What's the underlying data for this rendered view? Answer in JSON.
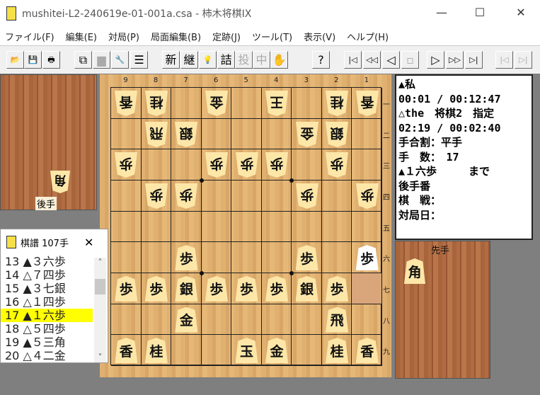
{
  "window": {
    "title": "mushitei-L2-240619e-01-001a.csa - 柿木将棋IX",
    "minimize": "—",
    "maximize": "☐",
    "close": "✕",
    "logo": "柿"
  },
  "menu": [
    "ファイル(F)",
    "編集(E)",
    "対局(P)",
    "局面編集(B)",
    "定跡(J)",
    "ツール(T)",
    "表示(V)",
    "ヘルプ(H)"
  ],
  "toolbar": [
    {
      "name": "open-button",
      "glyph": "📂",
      "enabled": true
    },
    {
      "name": "save-button",
      "glyph": "💾",
      "enabled": true
    },
    {
      "name": "print-button",
      "glyph": "🖶",
      "enabled": true
    },
    {
      "name": "copy-button",
      "glyph": "⧉",
      "enabled": true
    },
    {
      "name": "paste-button",
      "glyph": "▆",
      "enabled": false
    },
    {
      "name": "settings-button",
      "glyph": "🔧",
      "enabled": true
    },
    {
      "name": "list-button",
      "glyph": "☰",
      "enabled": true
    },
    {
      "name": "new-game-button",
      "glyph": "新",
      "enabled": true
    },
    {
      "name": "continue-button",
      "glyph": "継",
      "enabled": true
    },
    {
      "name": "hint-button",
      "glyph": "💡",
      "enabled": true
    },
    {
      "name": "tsume-button",
      "glyph": "詰",
      "enabled": true
    },
    {
      "name": "resign-button",
      "glyph": "投",
      "enabled": false
    },
    {
      "name": "pause-button",
      "glyph": "中",
      "enabled": false
    },
    {
      "name": "hand-button",
      "glyph": "✋",
      "enabled": false
    },
    {
      "name": "help-button",
      "glyph": "?",
      "enabled": true
    },
    {
      "name": "first-move-button",
      "glyph": "|◁",
      "enabled": true
    },
    {
      "name": "back-many-button",
      "glyph": "◁◁",
      "enabled": true
    },
    {
      "name": "back-button",
      "glyph": "◁",
      "enabled": true
    },
    {
      "name": "stop-button",
      "glyph": "▫",
      "enabled": false
    },
    {
      "name": "forward-button",
      "glyph": "▷",
      "enabled": true
    },
    {
      "name": "forward-many-button",
      "glyph": "▷▷",
      "enabled": true
    },
    {
      "name": "last-move-button",
      "glyph": "▷|",
      "enabled": true
    },
    {
      "name": "branch-back-button",
      "glyph": "|◁",
      "enabled": false
    },
    {
      "name": "branch-forward-button",
      "glyph": "▷|",
      "enabled": false
    }
  ],
  "board": {
    "files": [
      "9",
      "8",
      "7",
      "6",
      "5",
      "4",
      "3",
      "2",
      "1"
    ],
    "ranks": [
      "一",
      "二",
      "三",
      "四",
      "五",
      "六",
      "七",
      "八",
      "九"
    ],
    "highlight": {
      "file": 1,
      "rank": 7
    },
    "pieces": [
      {
        "f": 9,
        "r": 1,
        "p": "香",
        "o": "gote"
      },
      {
        "f": 8,
        "r": 1,
        "p": "桂",
        "o": "gote"
      },
      {
        "f": 6,
        "r": 1,
        "p": "金",
        "o": "gote"
      },
      {
        "f": 4,
        "r": 1,
        "p": "王",
        "o": "gote"
      },
      {
        "f": 2,
        "r": 1,
        "p": "桂",
        "o": "gote"
      },
      {
        "f": 1,
        "r": 1,
        "p": "香",
        "o": "gote"
      },
      {
        "f": 8,
        "r": 2,
        "p": "飛",
        "o": "gote"
      },
      {
        "f": 7,
        "r": 2,
        "p": "銀",
        "o": "gote"
      },
      {
        "f": 3,
        "r": 2,
        "p": "金",
        "o": "gote"
      },
      {
        "f": 2,
        "r": 2,
        "p": "銀",
        "o": "gote"
      },
      {
        "f": 9,
        "r": 3,
        "p": "歩",
        "o": "gote"
      },
      {
        "f": 6,
        "r": 3,
        "p": "歩",
        "o": "gote"
      },
      {
        "f": 5,
        "r": 3,
        "p": "歩",
        "o": "gote"
      },
      {
        "f": 4,
        "r": 3,
        "p": "歩",
        "o": "gote"
      },
      {
        "f": 2,
        "r": 3,
        "p": "歩",
        "o": "gote"
      },
      {
        "f": 8,
        "r": 4,
        "p": "歩",
        "o": "gote"
      },
      {
        "f": 7,
        "r": 4,
        "p": "歩",
        "o": "gote"
      },
      {
        "f": 3,
        "r": 4,
        "p": "歩",
        "o": "gote"
      },
      {
        "f": 1,
        "r": 4,
        "p": "歩",
        "o": "gote"
      },
      {
        "f": 7,
        "r": 6,
        "p": "歩",
        "o": "sente"
      },
      {
        "f": 3,
        "r": 6,
        "p": "歩",
        "o": "sente"
      },
      {
        "f": 1,
        "r": 6,
        "p": "歩",
        "o": "sente",
        "last": true
      },
      {
        "f": 9,
        "r": 7,
        "p": "歩",
        "o": "sente"
      },
      {
        "f": 8,
        "r": 7,
        "p": "歩",
        "o": "sente"
      },
      {
        "f": 7,
        "r": 7,
        "p": "銀",
        "o": "sente"
      },
      {
        "f": 6,
        "r": 7,
        "p": "歩",
        "o": "sente"
      },
      {
        "f": 5,
        "r": 7,
        "p": "歩",
        "o": "sente"
      },
      {
        "f": 4,
        "r": 7,
        "p": "歩",
        "o": "sente"
      },
      {
        "f": 3,
        "r": 7,
        "p": "銀",
        "o": "sente"
      },
      {
        "f": 2,
        "r": 7,
        "p": "歩",
        "o": "sente"
      },
      {
        "f": 7,
        "r": 8,
        "p": "金",
        "o": "sente"
      },
      {
        "f": 2,
        "r": 8,
        "p": "飛",
        "o": "sente"
      },
      {
        "f": 9,
        "r": 9,
        "p": "香",
        "o": "sente"
      },
      {
        "f": 8,
        "r": 9,
        "p": "桂",
        "o": "sente"
      },
      {
        "f": 5,
        "r": 9,
        "p": "玉",
        "o": "sente"
      },
      {
        "f": 4,
        "r": 9,
        "p": "金",
        "o": "sente"
      },
      {
        "f": 2,
        "r": 9,
        "p": "桂",
        "o": "sente"
      },
      {
        "f": 1,
        "r": 9,
        "p": "香",
        "o": "sente"
      }
    ]
  },
  "gote_hand": {
    "label": "後手",
    "pieces": [
      "角"
    ]
  },
  "sente_hand": {
    "label": "先手",
    "pieces": [
      "角"
    ]
  },
  "info": {
    "lines": [
      "▲私",
      "00:01 / 00:12:47",
      "△the　将棋2　指定",
      "02:19 / 00:02:40",
      "手合割：平手",
      "手　数：　17",
      "▲１六歩　　　まで",
      "後手番",
      "棋　戦：",
      "対局日："
    ]
  },
  "kifu": {
    "title": "棋譜 107手",
    "close": "✕",
    "rows": [
      "13 ▲３六歩",
      "14 △７四歩",
      "15 ▲３七銀",
      "16 △１四歩",
      "17 ▲１六歩",
      "18 △５四歩",
      "19 ▲５三角",
      "20 △４二金"
    ],
    "selected": 4,
    "scroll_up": "˄",
    "scroll_down": "˅"
  }
}
